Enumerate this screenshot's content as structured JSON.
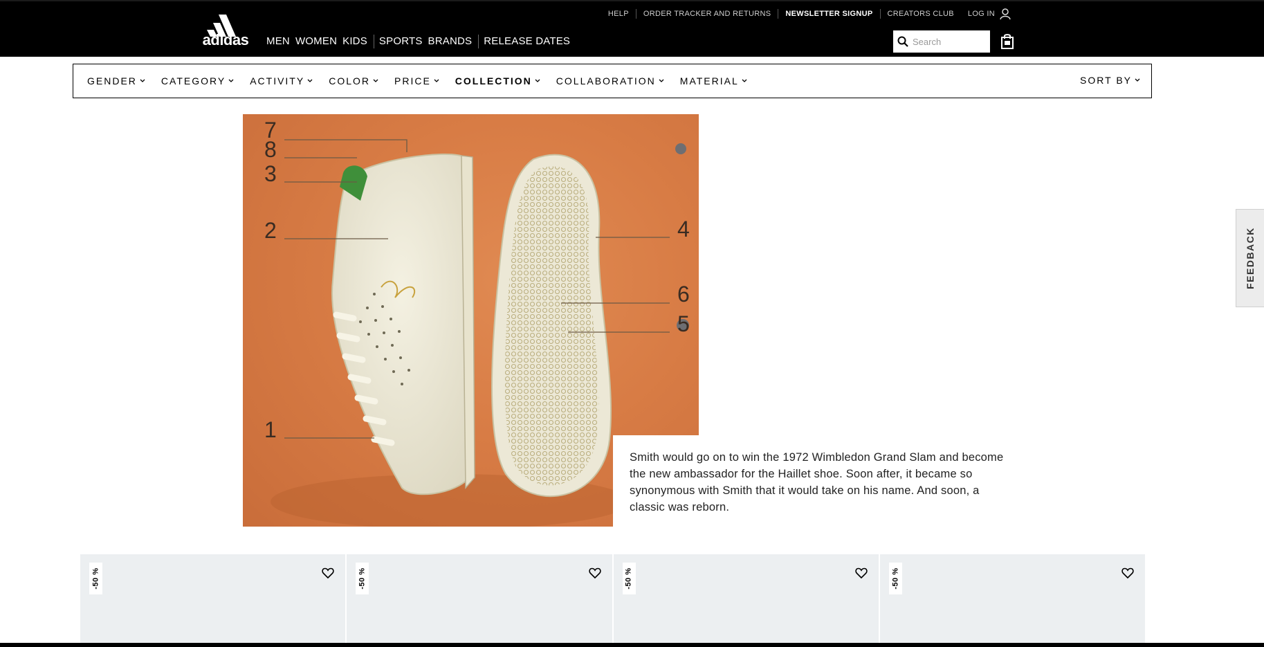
{
  "header": {
    "utility": [
      "HELP",
      "ORDER TRACKER AND RETURNS",
      "NEWSLETTER SIGNUP",
      "CREATORS CLUB"
    ],
    "login": "LOG IN",
    "logo_text": "adidas",
    "nav": [
      "MEN",
      "WOMEN",
      "KIDS",
      "SPORTS",
      "BRANDS",
      "RELEASE DATES"
    ],
    "search_placeholder": "Search"
  },
  "filters": [
    "GENDER",
    "CATEGORY",
    "ACTIVITY",
    "COLOR",
    "PRICE",
    "COLLECTION",
    "COLLABORATION",
    "MATERIAL"
  ],
  "sort_label": "SORT BY",
  "hero": {
    "labels": [
      "7",
      "8",
      "3",
      "2",
      "1",
      "4",
      "6",
      "5"
    ],
    "body": "Smith would go on to win the 1972 Wimbledon Grand Slam and become the new ambassador for the Haillet shoe. Soon after, it became so synonymous with Smith that it would take on his name. And soon, a classic was reborn."
  },
  "feedback_label": "FEEDBACK",
  "cards": [
    {
      "badge": "-50 %"
    },
    {
      "badge": "-50 %"
    },
    {
      "badge": "-50 %"
    },
    {
      "badge": "-50 %"
    }
  ],
  "colors": {
    "header_bg": "#000000",
    "hero_bg": "#d87c45",
    "card_bg": "#eceff1",
    "heel_tab": "#3f8f3a"
  }
}
